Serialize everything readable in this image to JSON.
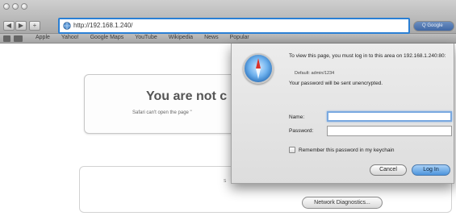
{
  "browser": {
    "url": "http://192.168.1.240/",
    "search_placeholder": "Q Google",
    "nav": {
      "back_glyph": "◀",
      "forward_glyph": "▶"
    },
    "bookmarks": [
      "Apple",
      "Yahoo!",
      "Google Maps",
      "YouTube",
      "Wikipedia",
      "News",
      "Popular"
    ],
    "accent_color": "#2a7fd4"
  },
  "error_page": {
    "title": "You are not c",
    "subtitle": "Safari can't open the page \"",
    "lower_text": "S",
    "diagnostics_button": "Network Diagnostics..."
  },
  "auth_dialog": {
    "message": "To view this page, you must log in to this area on 192.168.1.240:80:",
    "realm": "Default: admin/1234",
    "warning": "Your password will be sent unencrypted.",
    "name_label": "Name:",
    "name_value": "",
    "password_label": "Password:",
    "password_value": "",
    "remember_label": "Remember this password in my keychain",
    "remember_checked": false,
    "cancel_button": "Cancel",
    "login_button": "Log In"
  }
}
